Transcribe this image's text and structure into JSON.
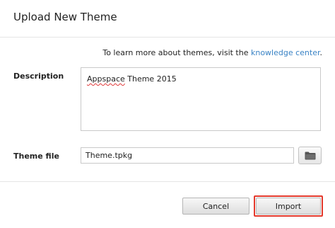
{
  "dialog": {
    "title": "Upload New Theme"
  },
  "info": {
    "prefix": "To learn more about themes, visit the ",
    "link_text": "knowledge center",
    "suffix": "."
  },
  "description": {
    "label": "Description",
    "value_word1": "Appspace",
    "value_rest": " Theme 2015"
  },
  "theme_file": {
    "label": "Theme file",
    "value": "Theme.tpkg",
    "browse_icon": "folder-icon"
  },
  "footer": {
    "cancel_label": "Cancel",
    "import_label": "Import",
    "highlight_color": "#e43a2d"
  },
  "colors": {
    "link": "#3a83c5"
  }
}
